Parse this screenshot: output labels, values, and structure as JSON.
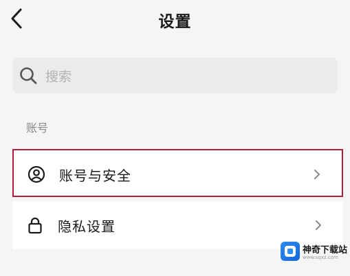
{
  "header": {
    "title": "设置",
    "back_icon": "chevron-left-icon"
  },
  "search": {
    "placeholder": "搜索",
    "icon": "search-icon"
  },
  "sections": [
    {
      "label": "账号",
      "items": [
        {
          "label": "账号与安全",
          "icon": "user-circle-icon",
          "highlighted": true
        },
        {
          "label": "隐私设置",
          "icon": "lock-icon",
          "highlighted": false
        }
      ]
    }
  ],
  "watermark": {
    "text": "神奇下载站",
    "subtext": "www.sqxz.com"
  },
  "colors": {
    "background": "#f5f5f5",
    "highlight_border": "#b51d3f",
    "watermark_blue": "#2f8cf0"
  }
}
